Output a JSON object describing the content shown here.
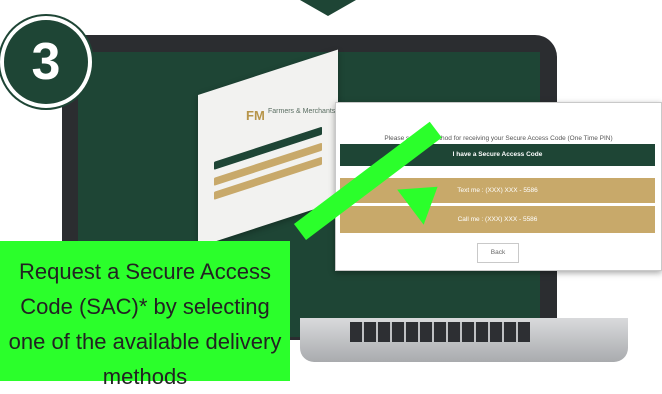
{
  "step_number": "3",
  "background_app": {
    "logo_mark": "FM",
    "logo_text": "Farmers & Merchants"
  },
  "dialog": {
    "prompt": "Please select a method for receiving your Secure Access Code (One Time PIN)",
    "have_code_label": "I have a Secure Access Code",
    "text_me_label": "Text me : (XXX) XXX - 5586",
    "call_me_label": "Call me : (XXX) XXX - 5586",
    "back_label": "Back"
  },
  "callout": {
    "text": "Request a Secure Access Code (SAC)* by selecting one of the available delivery methods"
  },
  "colors": {
    "brand_green": "#1e4535",
    "gold": "#c8a96a",
    "callout_green": "#2bff2b"
  }
}
